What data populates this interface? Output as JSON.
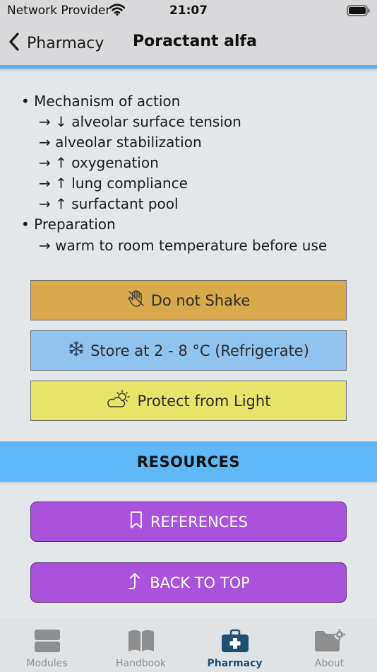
{
  "status_bar": {
    "carrier": "Network Provider",
    "time": "21:07"
  },
  "nav": {
    "back_label": "Pharmacy",
    "title": "Poractant alfa"
  },
  "content": {
    "sections": [
      {
        "heading": "Mechanism of action",
        "items": [
          "↓ alveolar surface tension",
          "alveolar stabilization",
          "↑ oxygenation",
          "↑ lung compliance",
          "↑ surfactant pool"
        ]
      },
      {
        "heading": "Preparation",
        "items": [
          "warm to room temperature before use"
        ]
      }
    ],
    "bullet_symbol": "•",
    "arrow_symbol": "→"
  },
  "info_buttons": {
    "shake": {
      "label": "Do not Shake",
      "icon": "hand-icon",
      "color": "#d7a94a"
    },
    "store": {
      "label": "Store at 2 - 8 °C (Refrigerate)",
      "icon": "snowflake-icon",
      "color": "#90c3ee"
    },
    "light": {
      "label": "Protect from Light",
      "icon": "sun-cloud-icon",
      "color": "#e7e46a"
    }
  },
  "resources": {
    "title": "RESOURCES",
    "references_label": "REFERENCES",
    "back_to_top_label": "BACK TO TOP",
    "button_color": "#ab52dc"
  },
  "tabs": [
    {
      "label": "Modules",
      "icon": "modules-icon",
      "active": false
    },
    {
      "label": "Handbook",
      "icon": "book-icon",
      "active": false
    },
    {
      "label": "Pharmacy",
      "icon": "medical-kit-icon",
      "active": true
    },
    {
      "label": "About",
      "icon": "folder-gear-icon",
      "active": false
    }
  ],
  "colors": {
    "accent": "#5ab0ef",
    "resources_band": "#60b7f6",
    "active_tab": "#1f4f73"
  }
}
